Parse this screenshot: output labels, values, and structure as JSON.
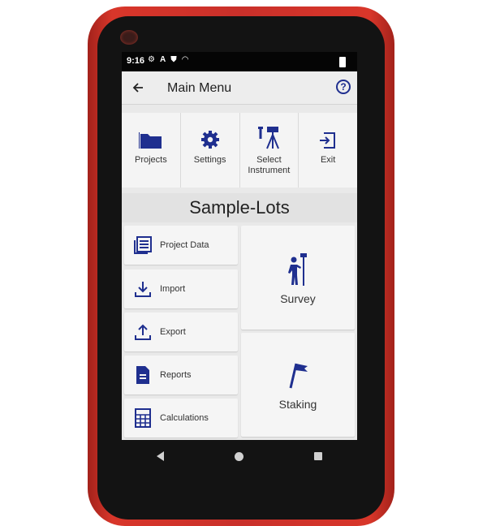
{
  "status_bar": {
    "time": "9:16",
    "icons": [
      "gear-icon",
      "a-icon",
      "shield-icon",
      "wifi-icon",
      "battery-icon"
    ]
  },
  "app_bar": {
    "title": "Main Menu",
    "help_label": "?"
  },
  "toolbar": {
    "projects_label": "Projects",
    "settings_label": "Settings",
    "select_instrument_label": "Select Instrument",
    "exit_label": "Exit"
  },
  "project": {
    "name": "Sample-Lots"
  },
  "menu": {
    "project_data_label": "Project Data",
    "import_label": "Import",
    "export_label": "Export",
    "reports_label": "Reports",
    "calculations_label": "Calculations",
    "survey_label": "Survey",
    "staking_label": "Staking"
  },
  "colors": {
    "accent": "#1f2f8f",
    "device": "#c9302a"
  }
}
